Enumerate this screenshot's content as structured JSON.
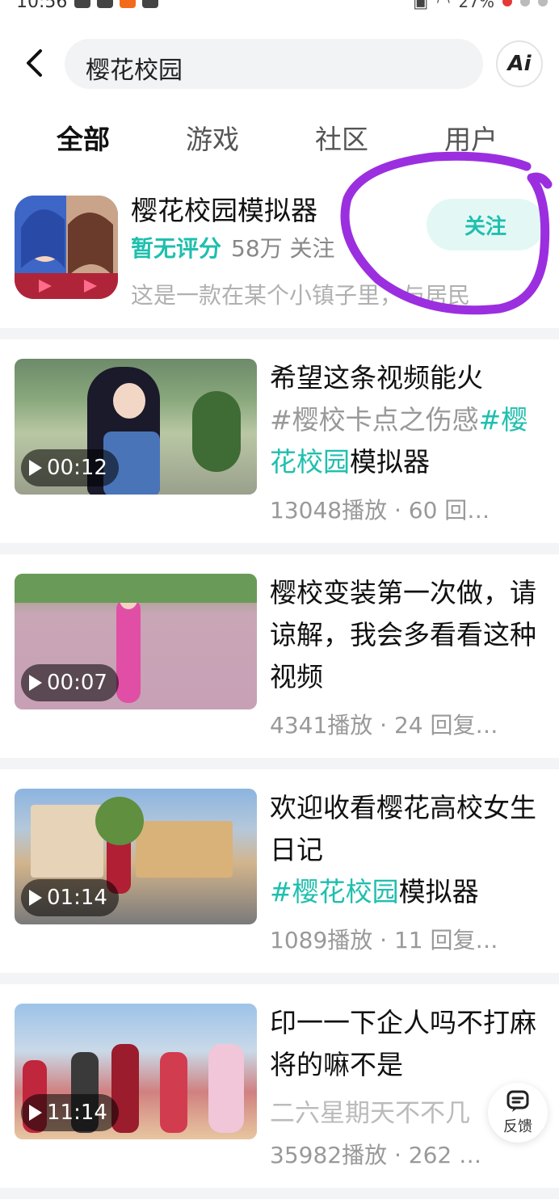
{
  "status_bar": {
    "time": "10:56",
    "battery": "27%"
  },
  "header": {
    "search_query": "樱花校园",
    "ai_label": "Ai"
  },
  "tabs": [
    {
      "label": "全部"
    },
    {
      "label": "游戏"
    },
    {
      "label": "社区"
    },
    {
      "label": "用户"
    }
  ],
  "game": {
    "title": "樱花校园模拟器",
    "rating": "暂无评分",
    "followers": "58万 关注",
    "description": "这是一款在某个小镇子里，与居民",
    "follow_label": "关注"
  },
  "videos": [
    {
      "duration": "00:12",
      "title_plain": "希望这条视频能火",
      "title_tag1": "#樱校卡点之伤感",
      "title_tag2": "#樱花校园",
      "title_suffix": "模拟器",
      "stats": "13048播放 · 60 回…"
    },
    {
      "duration": "00:07",
      "title_plain": "樱校变装第一次做，请谅解，我会多看看这种视频",
      "stats": "4341播放 · 24 回复…"
    },
    {
      "duration": "01:14",
      "title_plain": "欢迎收看樱花高校女生日记",
      "title_tag": "#樱花校园",
      "title_suffix": "模拟器",
      "stats": "1089播放 · 11 回复…"
    },
    {
      "duration": "11:14",
      "title_plain": "印一一下企人吗不打麻将的嘛不是",
      "subtitle": "二六星期天不不几",
      "stats": "35982播放 · 262 …"
    }
  ],
  "feedback": {
    "label": "反馈"
  },
  "colors": {
    "accent": "#1fbfae",
    "annotation": "#9b2fe0"
  }
}
